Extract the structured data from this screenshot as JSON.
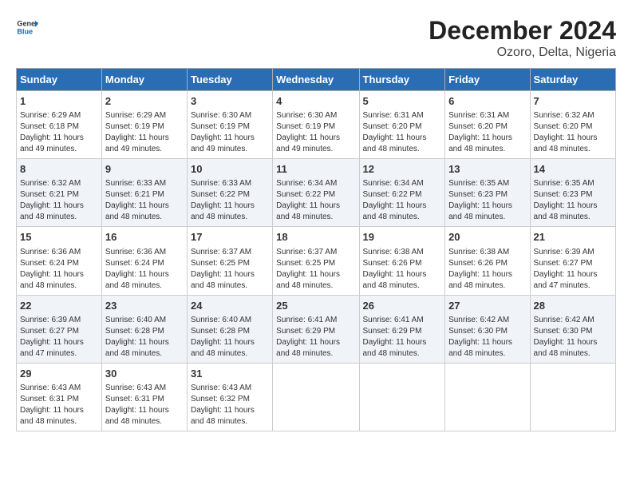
{
  "header": {
    "logo_general": "General",
    "logo_blue": "Blue",
    "title": "December 2024",
    "subtitle": "Ozoro, Delta, Nigeria"
  },
  "calendar": {
    "weekdays": [
      "Sunday",
      "Monday",
      "Tuesday",
      "Wednesday",
      "Thursday",
      "Friday",
      "Saturday"
    ],
    "weeks": [
      [
        {
          "day": "1",
          "info": "Sunrise: 6:29 AM\nSunset: 6:18 PM\nDaylight: 11 hours\nand 49 minutes."
        },
        {
          "day": "2",
          "info": "Sunrise: 6:29 AM\nSunset: 6:19 PM\nDaylight: 11 hours\nand 49 minutes."
        },
        {
          "day": "3",
          "info": "Sunrise: 6:30 AM\nSunset: 6:19 PM\nDaylight: 11 hours\nand 49 minutes."
        },
        {
          "day": "4",
          "info": "Sunrise: 6:30 AM\nSunset: 6:19 PM\nDaylight: 11 hours\nand 49 minutes."
        },
        {
          "day": "5",
          "info": "Sunrise: 6:31 AM\nSunset: 6:20 PM\nDaylight: 11 hours\nand 48 minutes."
        },
        {
          "day": "6",
          "info": "Sunrise: 6:31 AM\nSunset: 6:20 PM\nDaylight: 11 hours\nand 48 minutes."
        },
        {
          "day": "7",
          "info": "Sunrise: 6:32 AM\nSunset: 6:20 PM\nDaylight: 11 hours\nand 48 minutes."
        }
      ],
      [
        {
          "day": "8",
          "info": "Sunrise: 6:32 AM\nSunset: 6:21 PM\nDaylight: 11 hours\nand 48 minutes."
        },
        {
          "day": "9",
          "info": "Sunrise: 6:33 AM\nSunset: 6:21 PM\nDaylight: 11 hours\nand 48 minutes."
        },
        {
          "day": "10",
          "info": "Sunrise: 6:33 AM\nSunset: 6:22 PM\nDaylight: 11 hours\nand 48 minutes."
        },
        {
          "day": "11",
          "info": "Sunrise: 6:34 AM\nSunset: 6:22 PM\nDaylight: 11 hours\nand 48 minutes."
        },
        {
          "day": "12",
          "info": "Sunrise: 6:34 AM\nSunset: 6:22 PM\nDaylight: 11 hours\nand 48 minutes."
        },
        {
          "day": "13",
          "info": "Sunrise: 6:35 AM\nSunset: 6:23 PM\nDaylight: 11 hours\nand 48 minutes."
        },
        {
          "day": "14",
          "info": "Sunrise: 6:35 AM\nSunset: 6:23 PM\nDaylight: 11 hours\nand 48 minutes."
        }
      ],
      [
        {
          "day": "15",
          "info": "Sunrise: 6:36 AM\nSunset: 6:24 PM\nDaylight: 11 hours\nand 48 minutes."
        },
        {
          "day": "16",
          "info": "Sunrise: 6:36 AM\nSunset: 6:24 PM\nDaylight: 11 hours\nand 48 minutes."
        },
        {
          "day": "17",
          "info": "Sunrise: 6:37 AM\nSunset: 6:25 PM\nDaylight: 11 hours\nand 48 minutes."
        },
        {
          "day": "18",
          "info": "Sunrise: 6:37 AM\nSunset: 6:25 PM\nDaylight: 11 hours\nand 48 minutes."
        },
        {
          "day": "19",
          "info": "Sunrise: 6:38 AM\nSunset: 6:26 PM\nDaylight: 11 hours\nand 48 minutes."
        },
        {
          "day": "20",
          "info": "Sunrise: 6:38 AM\nSunset: 6:26 PM\nDaylight: 11 hours\nand 48 minutes."
        },
        {
          "day": "21",
          "info": "Sunrise: 6:39 AM\nSunset: 6:27 PM\nDaylight: 11 hours\nand 47 minutes."
        }
      ],
      [
        {
          "day": "22",
          "info": "Sunrise: 6:39 AM\nSunset: 6:27 PM\nDaylight: 11 hours\nand 47 minutes."
        },
        {
          "day": "23",
          "info": "Sunrise: 6:40 AM\nSunset: 6:28 PM\nDaylight: 11 hours\nand 48 minutes."
        },
        {
          "day": "24",
          "info": "Sunrise: 6:40 AM\nSunset: 6:28 PM\nDaylight: 11 hours\nand 48 minutes."
        },
        {
          "day": "25",
          "info": "Sunrise: 6:41 AM\nSunset: 6:29 PM\nDaylight: 11 hours\nand 48 minutes."
        },
        {
          "day": "26",
          "info": "Sunrise: 6:41 AM\nSunset: 6:29 PM\nDaylight: 11 hours\nand 48 minutes."
        },
        {
          "day": "27",
          "info": "Sunrise: 6:42 AM\nSunset: 6:30 PM\nDaylight: 11 hours\nand 48 minutes."
        },
        {
          "day": "28",
          "info": "Sunrise: 6:42 AM\nSunset: 6:30 PM\nDaylight: 11 hours\nand 48 minutes."
        }
      ],
      [
        {
          "day": "29",
          "info": "Sunrise: 6:43 AM\nSunset: 6:31 PM\nDaylight: 11 hours\nand 48 minutes."
        },
        {
          "day": "30",
          "info": "Sunrise: 6:43 AM\nSunset: 6:31 PM\nDaylight: 11 hours\nand 48 minutes."
        },
        {
          "day": "31",
          "info": "Sunrise: 6:43 AM\nSunset: 6:32 PM\nDaylight: 11 hours\nand 48 minutes."
        },
        {
          "day": "",
          "info": ""
        },
        {
          "day": "",
          "info": ""
        },
        {
          "day": "",
          "info": ""
        },
        {
          "day": "",
          "info": ""
        }
      ]
    ]
  }
}
